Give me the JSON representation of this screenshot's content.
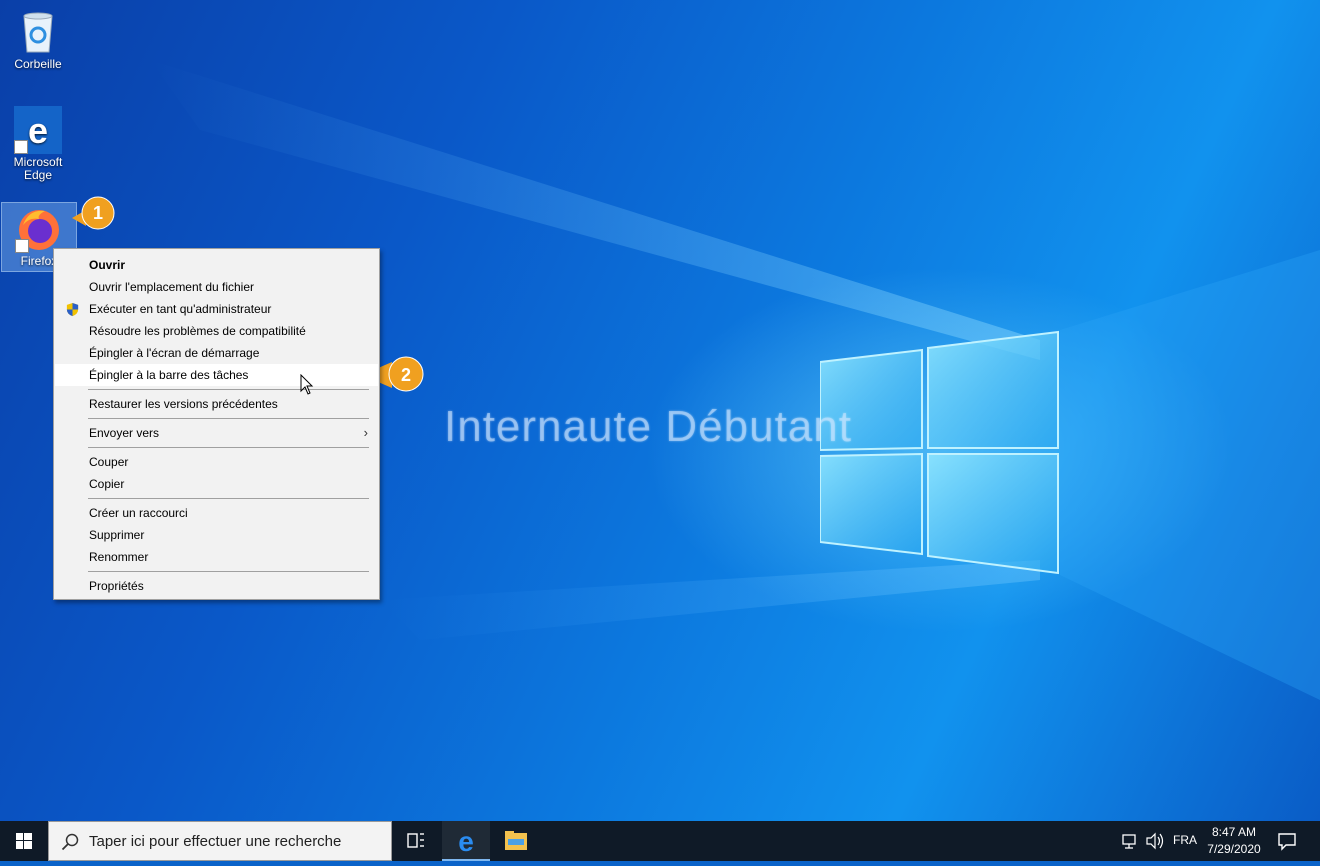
{
  "desktop": {
    "watermark": "Internaute Débutant",
    "icons": [
      {
        "label": "Corbeille"
      },
      {
        "label": "Microsoft Edge"
      },
      {
        "label": "Firefox"
      }
    ],
    "badges": [
      "1",
      "2"
    ],
    "colors": {
      "badge": "#f0a020",
      "menu_bg": "#f2f2f2",
      "taskbar": "#0f1a27"
    }
  },
  "context_menu": {
    "items": [
      {
        "label": "Ouvrir",
        "bold": true
      },
      {
        "label": "Ouvrir l'emplacement du fichier"
      },
      {
        "label": "Exécuter en tant qu'administrateur",
        "icon": "uac-shield-icon"
      },
      {
        "label": "Résoudre les problèmes de compatibilité"
      },
      {
        "label": "Épingler à l'écran de démarrage"
      },
      {
        "label": "Épingler à la barre des tâches",
        "highlighted": true
      },
      {
        "label": "Restaurer les versions précédentes"
      },
      {
        "label": "Envoyer vers",
        "submenu": true
      },
      {
        "label": "Couper"
      },
      {
        "label": "Copier"
      },
      {
        "label": "Créer un raccourci"
      },
      {
        "label": "Supprimer"
      },
      {
        "label": "Renommer"
      },
      {
        "label": "Propriétés"
      }
    ]
  },
  "taskbar": {
    "search_placeholder": "Taper ici pour effectuer une recherche",
    "language": "FRA",
    "time": "8:47 AM",
    "date": "7/29/2020"
  }
}
